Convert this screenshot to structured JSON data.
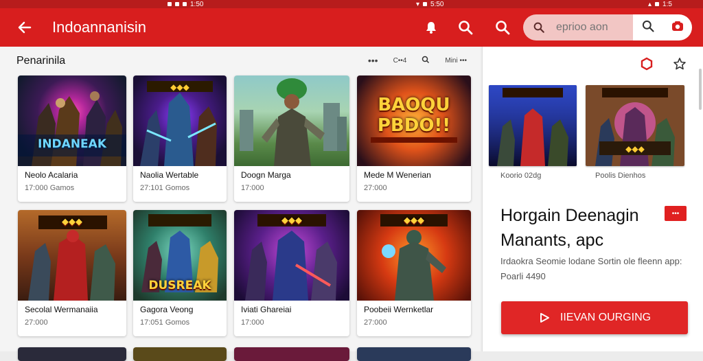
{
  "status": {
    "left_time": "1:50",
    "center_time": "5:50",
    "right_time": "1:5"
  },
  "appbar": {
    "title": "Indoannanisin",
    "search_placeholder": "eprioo aon"
  },
  "section": {
    "title": "Penarinila",
    "tool_label": "Mini •••"
  },
  "cards": [
    {
      "title": "Neolo Acalaria",
      "meta": "17:000 Gamos",
      "art": "INDANEAK"
    },
    {
      "title": "Naolia Wertable",
      "meta": "27:101 Gomos",
      "art": ""
    },
    {
      "title": "Doogn Marga",
      "meta": "17:000",
      "art": ""
    },
    {
      "title": "Mede M Wenerian",
      "meta": "27:000",
      "art": "BAOQU PBDO!!"
    },
    {
      "title": "Secolal Wermanaiia",
      "meta": "27:000",
      "art": ""
    },
    {
      "title": "Gagora Veong",
      "meta": "17:051 Gomos",
      "art": "DUSREAK"
    },
    {
      "title": "Iviati Ghareiai",
      "meta": "17:000",
      "art": ""
    },
    {
      "title": "Poobeii Wernketlar",
      "meta": "27:000",
      "art": ""
    }
  ],
  "detail": {
    "shots": [
      {
        "label": "Koorio 02dg"
      },
      {
        "label": "Poolis Dienhos"
      }
    ],
    "title": "Horgain Deenagin Manants, apc",
    "badge": "•••",
    "description": "Irdaokra Seomie lodane Sortin ole fleenn app: Poarli 4490",
    "cta_label": "IIEVAN OURGING"
  },
  "colors": {
    "primary": "#d81e1e",
    "primary_dark": "#b71c1c",
    "cta": "#e02626"
  }
}
